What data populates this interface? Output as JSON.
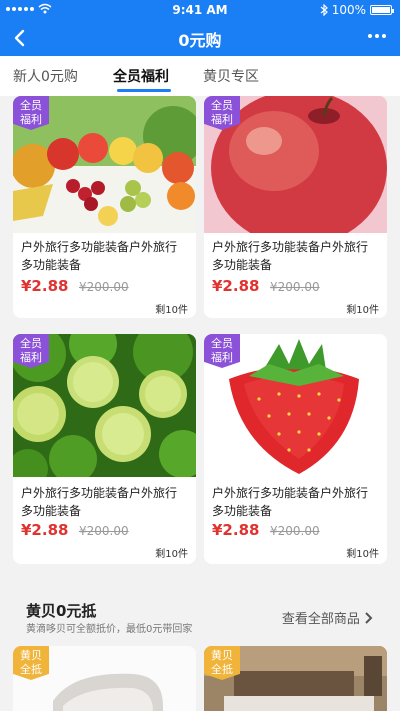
{
  "status": {
    "time": "9:41 AM",
    "battery": "100%"
  },
  "nav": {
    "title": "0元购"
  },
  "tabs": [
    {
      "label": "新人0元购"
    },
    {
      "label": "全员福利"
    },
    {
      "label": "黄贝专区"
    }
  ],
  "products": [
    {
      "badge": "全员福利",
      "title": "户外旅行多功能装备户外旅行多功能装备",
      "price": "¥2.88",
      "old_price": "¥200.00",
      "stock": "剩10件",
      "image": "mixed-fruit-image"
    },
    {
      "badge": "全员福利",
      "title": "户外旅行多功能装备户外旅行多功能装备",
      "price": "¥2.88",
      "old_price": "¥200.00",
      "stock": "剩10件",
      "image": "apple-image"
    },
    {
      "badge": "全员福利",
      "title": "户外旅行多功能装备户外旅行多功能装备",
      "price": "¥2.88",
      "old_price": "¥200.00",
      "stock": "剩10件",
      "image": "lime-image"
    },
    {
      "badge": "全员福利",
      "title": "户外旅行多功能装备户外旅行多功能装备",
      "price": "¥2.88",
      "old_price": "¥200.00",
      "stock": "剩10件",
      "image": "strawberry-image"
    }
  ],
  "section": {
    "title": "黄贝0元抵",
    "subtitle": "黄滴哆贝可全额抵价，最低0元带回家",
    "link": "查看全部商品"
  },
  "bottom_cards": [
    {
      "badge": "黄贝全抵",
      "image": "chair-image"
    },
    {
      "badge": "黄贝全抵",
      "image": "bedroom-image"
    }
  ],
  "colors": {
    "primary": "#1a7ef5",
    "badge_purple": "#8b52d9",
    "badge_gold": "#f0b43a",
    "price_red": "#e0322f"
  }
}
